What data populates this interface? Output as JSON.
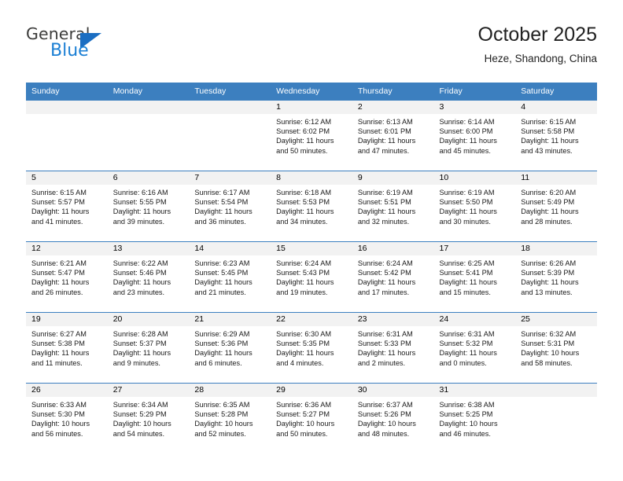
{
  "brand": {
    "name_top": "General",
    "name_bottom": "Blue",
    "color_dark": "#3c3c3b",
    "color_blue": "#1b7fd4",
    "triangle_color": "#1b6ec2"
  },
  "header": {
    "title": "October 2025",
    "subtitle": "Heze, Shandong, China",
    "accent_color": "#3c7fbf"
  },
  "calendar": {
    "weekday_headers": [
      "Sunday",
      "Monday",
      "Tuesday",
      "Wednesday",
      "Thursday",
      "Friday",
      "Saturday"
    ],
    "labels": {
      "sunrise": "Sunrise:",
      "sunset": "Sunset:",
      "daylight": "Daylight:"
    },
    "weeks": [
      [
        {
          "day": "",
          "empty": true
        },
        {
          "day": "",
          "empty": true
        },
        {
          "day": "",
          "empty": true
        },
        {
          "day": "1",
          "sunrise": "Sunrise: 6:12 AM",
          "sunset": "Sunset: 6:02 PM",
          "daylight_line1": "Daylight: 11 hours",
          "daylight_line2": "and 50 minutes."
        },
        {
          "day": "2",
          "sunrise": "Sunrise: 6:13 AM",
          "sunset": "Sunset: 6:01 PM",
          "daylight_line1": "Daylight: 11 hours",
          "daylight_line2": "and 47 minutes."
        },
        {
          "day": "3",
          "sunrise": "Sunrise: 6:14 AM",
          "sunset": "Sunset: 6:00 PM",
          "daylight_line1": "Daylight: 11 hours",
          "daylight_line2": "and 45 minutes."
        },
        {
          "day": "4",
          "sunrise": "Sunrise: 6:15 AM",
          "sunset": "Sunset: 5:58 PM",
          "daylight_line1": "Daylight: 11 hours",
          "daylight_line2": "and 43 minutes."
        }
      ],
      [
        {
          "day": "5",
          "sunrise": "Sunrise: 6:15 AM",
          "sunset": "Sunset: 5:57 PM",
          "daylight_line1": "Daylight: 11 hours",
          "daylight_line2": "and 41 minutes."
        },
        {
          "day": "6",
          "sunrise": "Sunrise: 6:16 AM",
          "sunset": "Sunset: 5:55 PM",
          "daylight_line1": "Daylight: 11 hours",
          "daylight_line2": "and 39 minutes."
        },
        {
          "day": "7",
          "sunrise": "Sunrise: 6:17 AM",
          "sunset": "Sunset: 5:54 PM",
          "daylight_line1": "Daylight: 11 hours",
          "daylight_line2": "and 36 minutes."
        },
        {
          "day": "8",
          "sunrise": "Sunrise: 6:18 AM",
          "sunset": "Sunset: 5:53 PM",
          "daylight_line1": "Daylight: 11 hours",
          "daylight_line2": "and 34 minutes."
        },
        {
          "day": "9",
          "sunrise": "Sunrise: 6:19 AM",
          "sunset": "Sunset: 5:51 PM",
          "daylight_line1": "Daylight: 11 hours",
          "daylight_line2": "and 32 minutes."
        },
        {
          "day": "10",
          "sunrise": "Sunrise: 6:19 AM",
          "sunset": "Sunset: 5:50 PM",
          "daylight_line1": "Daylight: 11 hours",
          "daylight_line2": "and 30 minutes."
        },
        {
          "day": "11",
          "sunrise": "Sunrise: 6:20 AM",
          "sunset": "Sunset: 5:49 PM",
          "daylight_line1": "Daylight: 11 hours",
          "daylight_line2": "and 28 minutes."
        }
      ],
      [
        {
          "day": "12",
          "sunrise": "Sunrise: 6:21 AM",
          "sunset": "Sunset: 5:47 PM",
          "daylight_line1": "Daylight: 11 hours",
          "daylight_line2": "and 26 minutes."
        },
        {
          "day": "13",
          "sunrise": "Sunrise: 6:22 AM",
          "sunset": "Sunset: 5:46 PM",
          "daylight_line1": "Daylight: 11 hours",
          "daylight_line2": "and 23 minutes."
        },
        {
          "day": "14",
          "sunrise": "Sunrise: 6:23 AM",
          "sunset": "Sunset: 5:45 PM",
          "daylight_line1": "Daylight: 11 hours",
          "daylight_line2": "and 21 minutes."
        },
        {
          "day": "15",
          "sunrise": "Sunrise: 6:24 AM",
          "sunset": "Sunset: 5:43 PM",
          "daylight_line1": "Daylight: 11 hours",
          "daylight_line2": "and 19 minutes."
        },
        {
          "day": "16",
          "sunrise": "Sunrise: 6:24 AM",
          "sunset": "Sunset: 5:42 PM",
          "daylight_line1": "Daylight: 11 hours",
          "daylight_line2": "and 17 minutes."
        },
        {
          "day": "17",
          "sunrise": "Sunrise: 6:25 AM",
          "sunset": "Sunset: 5:41 PM",
          "daylight_line1": "Daylight: 11 hours",
          "daylight_line2": "and 15 minutes."
        },
        {
          "day": "18",
          "sunrise": "Sunrise: 6:26 AM",
          "sunset": "Sunset: 5:39 PM",
          "daylight_line1": "Daylight: 11 hours",
          "daylight_line2": "and 13 minutes."
        }
      ],
      [
        {
          "day": "19",
          "sunrise": "Sunrise: 6:27 AM",
          "sunset": "Sunset: 5:38 PM",
          "daylight_line1": "Daylight: 11 hours",
          "daylight_line2": "and 11 minutes."
        },
        {
          "day": "20",
          "sunrise": "Sunrise: 6:28 AM",
          "sunset": "Sunset: 5:37 PM",
          "daylight_line1": "Daylight: 11 hours",
          "daylight_line2": "and 9 minutes."
        },
        {
          "day": "21",
          "sunrise": "Sunrise: 6:29 AM",
          "sunset": "Sunset: 5:36 PM",
          "daylight_line1": "Daylight: 11 hours",
          "daylight_line2": "and 6 minutes."
        },
        {
          "day": "22",
          "sunrise": "Sunrise: 6:30 AM",
          "sunset": "Sunset: 5:35 PM",
          "daylight_line1": "Daylight: 11 hours",
          "daylight_line2": "and 4 minutes."
        },
        {
          "day": "23",
          "sunrise": "Sunrise: 6:31 AM",
          "sunset": "Sunset: 5:33 PM",
          "daylight_line1": "Daylight: 11 hours",
          "daylight_line2": "and 2 minutes."
        },
        {
          "day": "24",
          "sunrise": "Sunrise: 6:31 AM",
          "sunset": "Sunset: 5:32 PM",
          "daylight_line1": "Daylight: 11 hours",
          "daylight_line2": "and 0 minutes."
        },
        {
          "day": "25",
          "sunrise": "Sunrise: 6:32 AM",
          "sunset": "Sunset: 5:31 PM",
          "daylight_line1": "Daylight: 10 hours",
          "daylight_line2": "and 58 minutes."
        }
      ],
      [
        {
          "day": "26",
          "sunrise": "Sunrise: 6:33 AM",
          "sunset": "Sunset: 5:30 PM",
          "daylight_line1": "Daylight: 10 hours",
          "daylight_line2": "and 56 minutes."
        },
        {
          "day": "27",
          "sunrise": "Sunrise: 6:34 AM",
          "sunset": "Sunset: 5:29 PM",
          "daylight_line1": "Daylight: 10 hours",
          "daylight_line2": "and 54 minutes."
        },
        {
          "day": "28",
          "sunrise": "Sunrise: 6:35 AM",
          "sunset": "Sunset: 5:28 PM",
          "daylight_line1": "Daylight: 10 hours",
          "daylight_line2": "and 52 minutes."
        },
        {
          "day": "29",
          "sunrise": "Sunrise: 6:36 AM",
          "sunset": "Sunset: 5:27 PM",
          "daylight_line1": "Daylight: 10 hours",
          "daylight_line2": "and 50 minutes."
        },
        {
          "day": "30",
          "sunrise": "Sunrise: 6:37 AM",
          "sunset": "Sunset: 5:26 PM",
          "daylight_line1": "Daylight: 10 hours",
          "daylight_line2": "and 48 minutes."
        },
        {
          "day": "31",
          "sunrise": "Sunrise: 6:38 AM",
          "sunset": "Sunset: 5:25 PM",
          "daylight_line1": "Daylight: 10 hours",
          "daylight_line2": "and 46 minutes."
        },
        {
          "day": "",
          "empty": true
        }
      ]
    ]
  }
}
